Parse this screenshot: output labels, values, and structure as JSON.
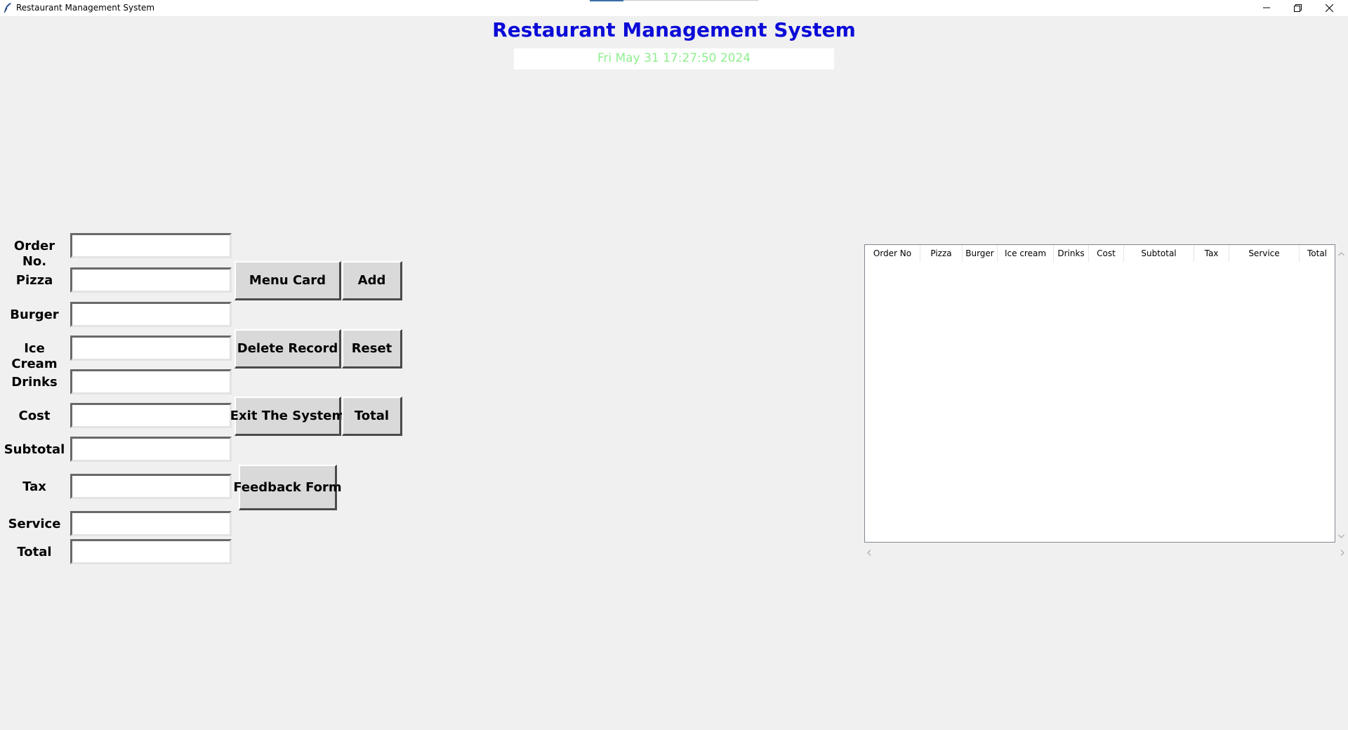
{
  "window": {
    "title": "Restaurant Management System",
    "icon": "feather-icon",
    "controls": [
      "minimize-icon",
      "maximize-icon",
      "close-icon"
    ]
  },
  "header": {
    "title": "Restaurant Management System",
    "clock": "Fri May 31 17:27:50 2024",
    "title_color": "#0b0bd8",
    "clock_color": "#90ee90"
  },
  "form": {
    "labels": {
      "order_no": "Order No.",
      "pizza": "Pizza",
      "burger": "Burger",
      "ice_cream": "Ice Cream",
      "drinks": "Drinks",
      "cost": "Cost",
      "subtotal": "Subtotal",
      "tax": "Tax",
      "service": "Service",
      "total": "Total"
    },
    "values": {
      "order_no": "",
      "pizza": "",
      "burger": "",
      "ice_cream": "",
      "drinks": "",
      "cost": "",
      "subtotal": "",
      "tax": "",
      "service": "",
      "total": ""
    }
  },
  "buttons": {
    "menu_card": "Menu Card",
    "add": "Add",
    "delete_record": "Delete Record",
    "reset": "Reset",
    "exit_system": "Exit The System",
    "total": "Total",
    "feedback_form": "Feedback Form"
  },
  "table": {
    "columns": [
      "Order No",
      "Pizza",
      "Burger",
      "Ice cream",
      "Drinks",
      "Cost",
      "Subtotal",
      "Tax",
      "Service",
      "Total"
    ],
    "rows": []
  }
}
